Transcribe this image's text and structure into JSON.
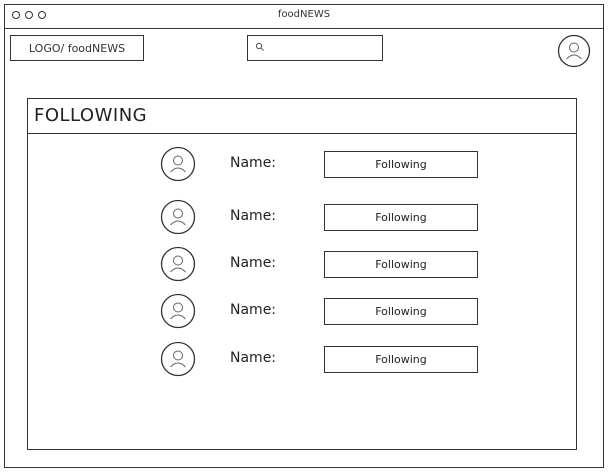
{
  "window": {
    "title": "foodNEWS"
  },
  "header": {
    "logo_label": "LOGO/ foodNEWS",
    "search": {
      "placeholder": "",
      "icon": "search-icon"
    },
    "profile_icon": "user-avatar-icon"
  },
  "panel": {
    "title": "FOLLOWING",
    "items": [
      {
        "name_label": "Name:",
        "button_label": "Following",
        "icon": "user-avatar-icon"
      },
      {
        "name_label": "Name:",
        "button_label": "Following",
        "icon": "user-avatar-icon"
      },
      {
        "name_label": "Name:",
        "button_label": "Following",
        "icon": "user-avatar-icon"
      },
      {
        "name_label": "Name:",
        "button_label": "Following",
        "icon": "user-avatar-icon"
      },
      {
        "name_label": "Name:",
        "button_label": "Following",
        "icon": "user-avatar-icon"
      }
    ]
  },
  "colors": {
    "stroke": "#333333",
    "background": "#ffffff"
  }
}
